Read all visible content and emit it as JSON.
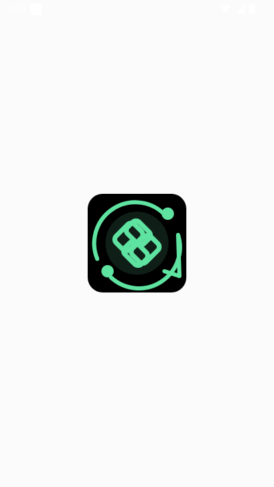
{
  "status_bar": {
    "time": "3:46",
    "icons": [
      "notification-icon",
      "wifi-icon",
      "signal-icon",
      "battery-icon"
    ],
    "icon_color": "#ffffff"
  },
  "splash": {
    "logo": "app-logo-knot-chat",
    "colors": {
      "background": "#fbfbfb",
      "logo_bg": "#000000",
      "accent": "#5fe3a1",
      "inner_circle": "#0f1f18"
    }
  }
}
